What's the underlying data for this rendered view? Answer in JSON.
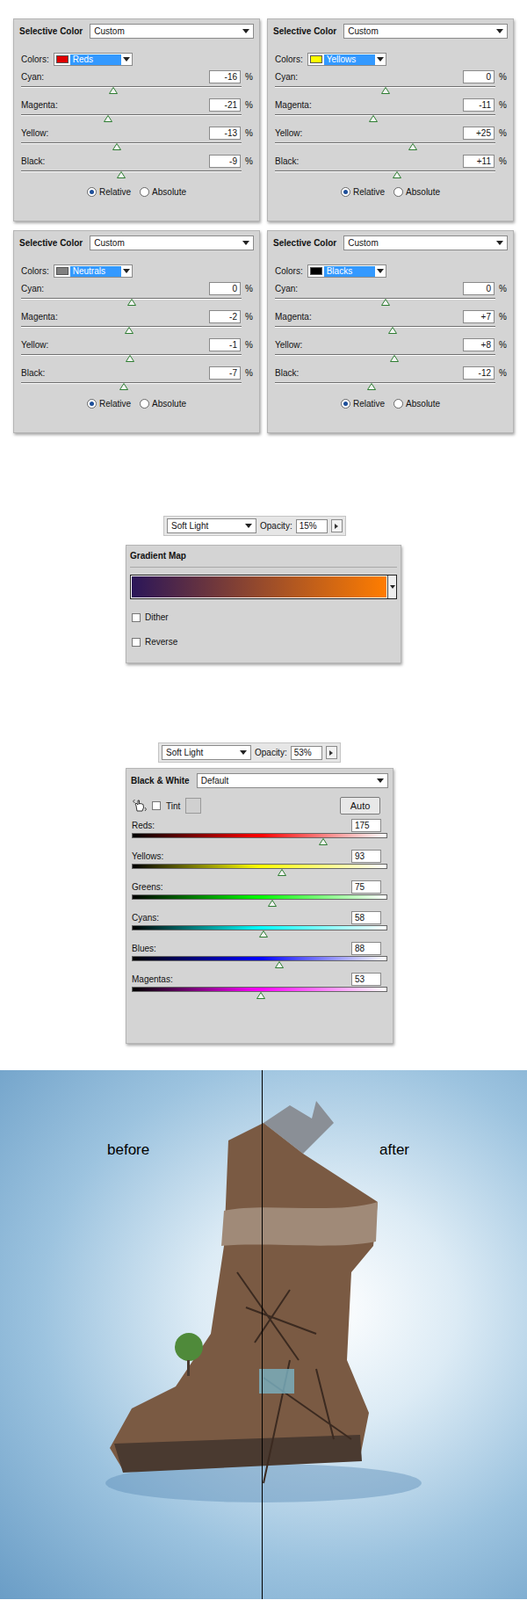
{
  "selective_color_panels": [
    {
      "title": "Selective Color",
      "preset": "Custom",
      "colors_label": "Colors:",
      "color_name": "Reds",
      "color": "#e00000",
      "sliders": [
        {
          "label": "Cyan:",
          "value": "-16",
          "unit": "%",
          "level": 0.42
        },
        {
          "label": "Magenta:",
          "value": "-21",
          "unit": "%",
          "level": 0.395
        },
        {
          "label": "Yellow:",
          "value": "-13",
          "unit": "%",
          "level": 0.435
        },
        {
          "label": "Black:",
          "value": "-9",
          "unit": "%",
          "level": 0.455
        }
      ],
      "method": [
        {
          "label": "Relative",
          "selected": true
        },
        {
          "label": "Absolute",
          "selected": false
        }
      ]
    },
    {
      "title": "Selective Color",
      "preset": "Custom",
      "colors_label": "Colors:",
      "color_name": "Yellows",
      "color": "#ffff00",
      "sliders": [
        {
          "label": "Cyan:",
          "value": "0",
          "unit": "%",
          "level": 0.5
        },
        {
          "label": "Magenta:",
          "value": "-11",
          "unit": "%",
          "level": 0.445
        },
        {
          "label": "Yellow:",
          "value": "+25",
          "unit": "%",
          "level": 0.625
        },
        {
          "label": "Black:",
          "value": "+11",
          "unit": "%",
          "level": 0.555
        }
      ],
      "method": [
        {
          "label": "Relative",
          "selected": true
        },
        {
          "label": "Absolute",
          "selected": false
        }
      ]
    },
    {
      "title": "Selective Color",
      "preset": "Custom",
      "colors_label": "Colors:",
      "color_name": "Neutrals",
      "color": "#808080",
      "sliders": [
        {
          "label": "Cyan:",
          "value": "0",
          "unit": "%",
          "level": 0.5
        },
        {
          "label": "Magenta:",
          "value": "-2",
          "unit": "%",
          "level": 0.49
        },
        {
          "label": "Yellow:",
          "value": "-1",
          "unit": "%",
          "level": 0.495
        },
        {
          "label": "Black:",
          "value": "-7",
          "unit": "%",
          "level": 0.465
        }
      ],
      "method": [
        {
          "label": "Relative",
          "selected": true
        },
        {
          "label": "Absolute",
          "selected": false
        }
      ]
    },
    {
      "title": "Selective Color",
      "preset": "Custom",
      "colors_label": "Colors:",
      "color_name": "Blacks",
      "color": "#000000",
      "sliders": [
        {
          "label": "Cyan:",
          "value": "0",
          "unit": "%",
          "level": 0.5
        },
        {
          "label": "Magenta:",
          "value": "+7",
          "unit": "%",
          "level": 0.535
        },
        {
          "label": "Yellow:",
          "value": "+8",
          "unit": "%",
          "level": 0.54
        },
        {
          "label": "Black:",
          "value": "-12",
          "unit": "%",
          "level": 0.44
        }
      ],
      "method": [
        {
          "label": "Relative",
          "selected": true
        },
        {
          "label": "Absolute",
          "selected": false
        }
      ]
    }
  ],
  "gradient_map": {
    "blend_mode": "Soft Light",
    "opacity_label": "Opacity:",
    "opacity": "15%",
    "title": "Gradient Map",
    "gradient_start": "#2b1659",
    "gradient_end": "#ff7d00",
    "options": [
      {
        "label": "Dither",
        "checked": false
      },
      {
        "label": "Reverse",
        "checked": false
      }
    ]
  },
  "black_white": {
    "blend_mode": "Soft Light",
    "opacity_label": "Opacity:",
    "opacity": "53%",
    "title": "Black & White",
    "preset": "Default",
    "tint": {
      "label": "Tint",
      "checked": false
    },
    "auto_button": "Auto",
    "sliders": [
      {
        "label": "Reds:",
        "value": "175",
        "level": 0.75,
        "color": "#ff0000"
      },
      {
        "label": "Yellows:",
        "value": "93",
        "level": 0.586,
        "color": "#ffff00"
      },
      {
        "label": "Greens:",
        "value": "75",
        "level": 0.55,
        "color": "#00ff00"
      },
      {
        "label": "Cyans:",
        "value": "58",
        "level": 0.516,
        "color": "#00ffff"
      },
      {
        "label": "Blues:",
        "value": "88",
        "level": 0.576,
        "color": "#0000ff"
      },
      {
        "label": "Magentas:",
        "value": "53",
        "level": 0.506,
        "color": "#ff00ff"
      }
    ]
  },
  "comparison": {
    "before_label": "before",
    "after_label": "after"
  }
}
